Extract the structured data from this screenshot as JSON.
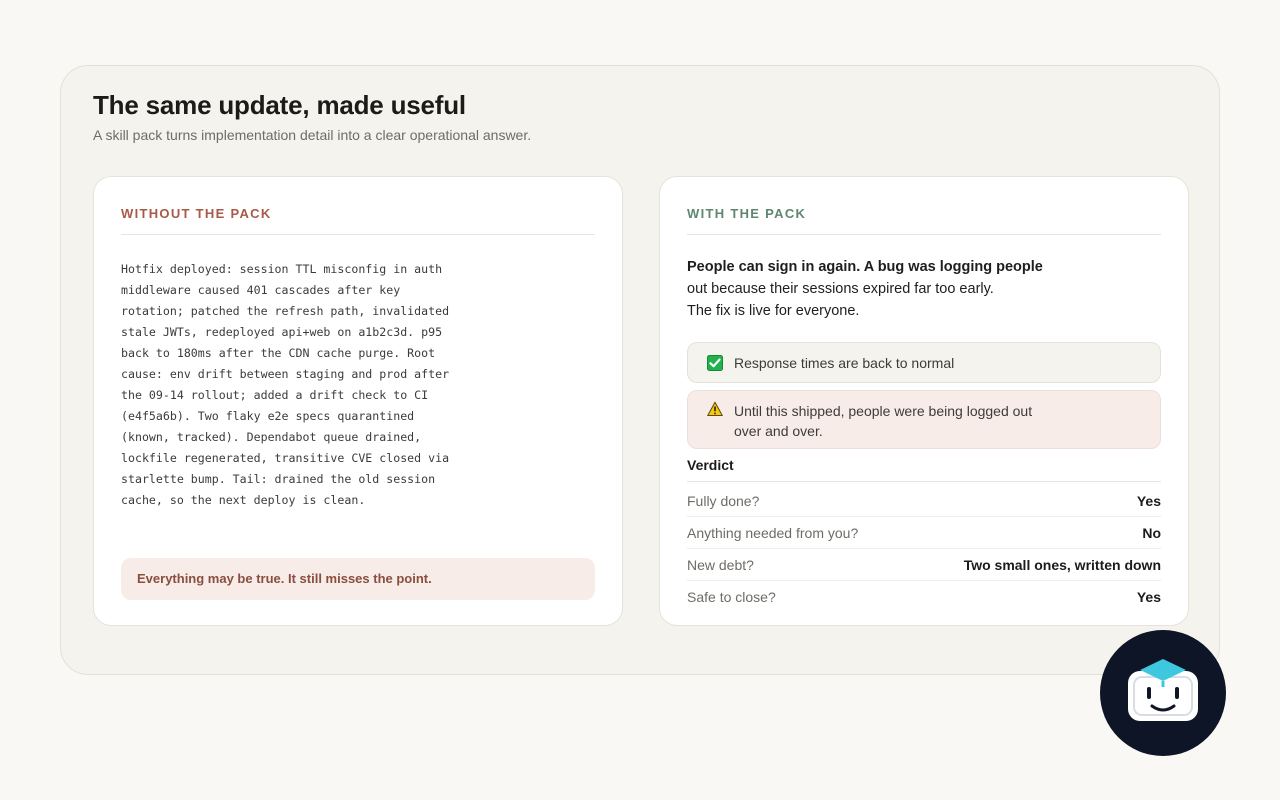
{
  "page": {
    "title": "The same update, made useful",
    "subtitle": "A skill pack turns implementation detail into a clear operational answer."
  },
  "without": {
    "heading": "WITHOUT THE PACK",
    "raw_update": "Hotfix deployed: session TTL misconfig in auth middleware caused 401 cascades after key rotation; patched the refresh path, invalidated stale JWTs, redeployed api+web on a1b2c3d. p95 back to 180ms after the CDN cache purge. Root cause: env drift between staging and prod after the 09-14 rollout; added a drift check to CI (e4f5a6b). Two flaky e2e specs quarantined (known, tracked). Dependabot queue drained, lockfile regenerated, transitive CVE closed via starlette bump. Tail: drained the old session cache, so the next deploy is clean.",
    "note": "Everything may be true. It still misses the point."
  },
  "with": {
    "heading": "WITH THE PACK",
    "summary_lead": "People can sign in again. A bug was logging people",
    "summary_rest_1": "out because their sessions expired far too early.",
    "summary_rest_2": "The fix is live for everyone.",
    "callout_ok": "Response times are back to normal",
    "callout_warn_1": "Until this shipped, people were being logged out",
    "callout_warn_2": "over and over.",
    "verdict_title": "Verdict",
    "verdict": [
      {
        "label": "Fully done?",
        "value": "Yes"
      },
      {
        "label": "Anything needed from you?",
        "value": "No"
      },
      {
        "label": "New debt?",
        "value": "Two small ones, written down"
      },
      {
        "label": "Safe to close?",
        "value": "Yes"
      }
    ]
  },
  "icons": {
    "ok": "check-box-icon",
    "warn": "warning-icon",
    "avatar": "assistant-avatar-icon"
  },
  "colors": {
    "without_accent": "#a85a48",
    "with_accent": "#5e8670",
    "check_green": "#22b14c",
    "warning_yellow": "#f5c518",
    "avatar_bg": "#0d1526",
    "avatar_cap": "#3ec8e0"
  }
}
